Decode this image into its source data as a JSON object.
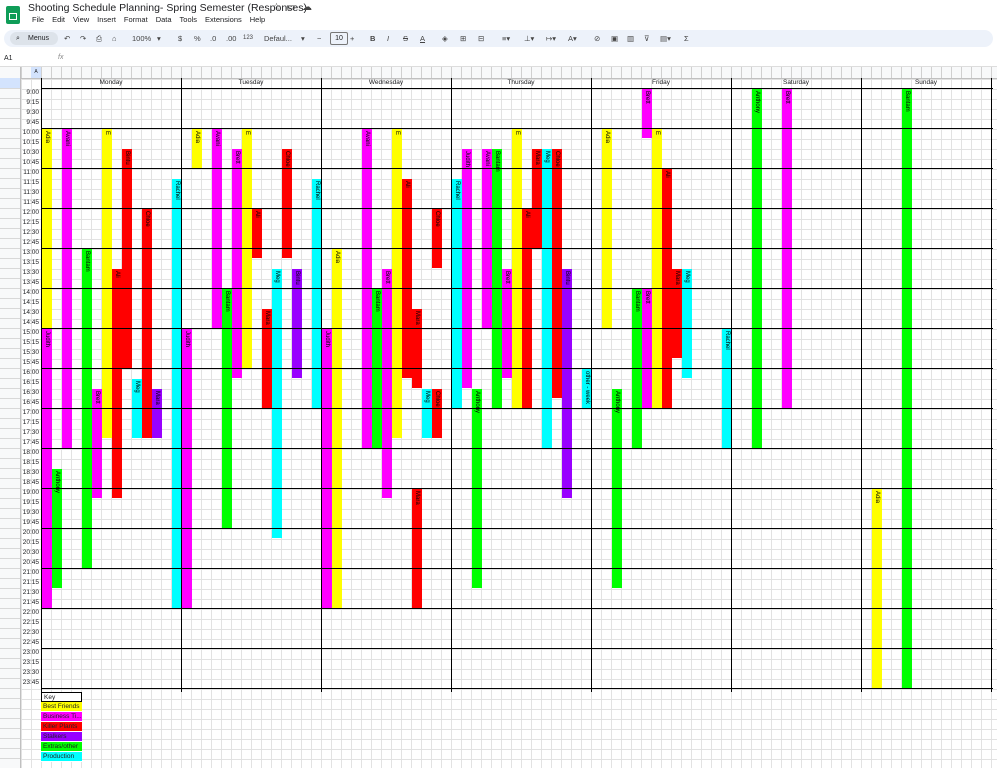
{
  "app": {
    "title": "Shooting Schedule Planning- Spring Semester (Responses)",
    "menus": [
      "File",
      "Edit",
      "View",
      "Insert",
      "Format",
      "Data",
      "Tools",
      "Extensions",
      "Help"
    ]
  },
  "toolbar": {
    "menus_label": "Menus",
    "zoom": "100%",
    "currency": "$",
    "percent": "%",
    "dec_decrease": ".0",
    "dec_increase": ".00",
    "number_format": "123",
    "font": "Defaul...",
    "font_size": "10",
    "bold": "B",
    "italic": "I",
    "strike": "S",
    "text_color": "A",
    "sum": "Σ"
  },
  "formula": {
    "cell": "A1",
    "fx": "fx"
  },
  "days": [
    "Monday",
    "Tuesday",
    "Wednesday",
    "Thursday",
    "Friday",
    "Saturday",
    "Sunday"
  ],
  "times": [
    "9:00",
    "9:15",
    "9:30",
    "9:45",
    "10:00",
    "10:15",
    "10:30",
    "10:45",
    "11:00",
    "11:15",
    "11:30",
    "11:45",
    "12:00",
    "12:15",
    "12:30",
    "12:45",
    "13:00",
    "13:15",
    "13:30",
    "13:45",
    "14:00",
    "14:15",
    "14:30",
    "14:45",
    "15:00",
    "15:15",
    "15:30",
    "15:45",
    "16:00",
    "16:15",
    "16:30",
    "16:45",
    "17:00",
    "17:15",
    "17:30",
    "17:45",
    "18:00",
    "18:15",
    "18:30",
    "18:45",
    "19:00",
    "19:15",
    "19:30",
    "19:45",
    "20:00",
    "20:15",
    "20:30",
    "20:45",
    "21:00",
    "21:15",
    "21:30",
    "21:45",
    "22:00",
    "22:15",
    "22:30",
    "22:45",
    "23:00",
    "23:15",
    "23:30",
    "23:45"
  ],
  "categories": {
    "bf": {
      "label": "Best Friends",
      "color": "#ffff00"
    },
    "bt": {
      "label": "Business Ti...",
      "color": "#ff00ff"
    },
    "kp": {
      "label": "Killer Plants",
      "color": "#ff0000"
    },
    "st": {
      "label": "Stalkers",
      "color": "#9900ff"
    },
    "ex": {
      "label": "Extras/other",
      "color": "#00ff00"
    },
    "pr": {
      "label": "Production",
      "color": "#00ffff"
    }
  },
  "legend": {
    "title": "Key",
    "items": [
      "bf",
      "bt",
      "kp",
      "st",
      "ex",
      "pr"
    ]
  },
  "people": {
    "adia": "Adia",
    "avani": "Avani",
    "e": "E",
    "bintu": "Bintu",
    "ali": "Ali",
    "chloe": "Chloe",
    "rachel": "Rachel",
    "judith": "Judith",
    "bantam": "Bantam",
    "brett": "Brett",
    "meg": "Meg",
    "mara": "Mara",
    "anthony": "Anthony",
    "other": "other - week"
  },
  "shifts": [
    {
      "c": 0,
      "s": 4,
      "e": 36,
      "k": "bf",
      "p": "adia"
    },
    {
      "c": -2,
      "s": 24,
      "e": 52,
      "k": "bt",
      "p": "judith"
    },
    {
      "c": 2,
      "s": 4,
      "e": 36,
      "k": "bt",
      "p": "avani"
    },
    {
      "c": 1,
      "s": 38,
      "e": 50,
      "k": "ex",
      "p": "anthony"
    },
    {
      "c": 4,
      "s": 16,
      "e": 48,
      "k": "ex",
      "p": "bantam"
    },
    {
      "c": 5,
      "s": 30,
      "e": 41,
      "k": "bt",
      "p": "brett"
    },
    {
      "c": 6,
      "s": 4,
      "e": 35,
      "k": "bf",
      "p": "e"
    },
    {
      "c": 7,
      "s": 18,
      "e": 41,
      "k": "kp",
      "p": "ali"
    },
    {
      "c": 8,
      "s": 6,
      "e": 28,
      "k": "kp",
      "p": "bintu"
    },
    {
      "c": 9,
      "s": 29,
      "e": 35,
      "k": "pr",
      "p": "meg"
    },
    {
      "c": 10,
      "s": 12,
      "e": 35,
      "k": "kp",
      "p": "chloe"
    },
    {
      "c": 11,
      "s": 30,
      "e": 35,
      "k": "st",
      "p": "mara"
    },
    {
      "c": 13,
      "s": 9,
      "e": 52,
      "k": "pr",
      "p": "rachel"
    },
    {
      "c": 14,
      "s": 24,
      "e": 52,
      "k": "bt",
      "p": "judith"
    },
    {
      "c": 15,
      "s": 4,
      "e": 8,
      "k": "bf",
      "p": "adia"
    },
    {
      "c": 17,
      "s": 4,
      "e": 24,
      "k": "bt",
      "p": "avani"
    },
    {
      "c": 18,
      "s": 20,
      "e": 44,
      "k": "ex",
      "p": "bantam"
    },
    {
      "c": 19,
      "s": 6,
      "e": 29,
      "k": "bt",
      "p": "brett"
    },
    {
      "c": 20,
      "s": 4,
      "e": 28,
      "k": "bf",
      "p": "e"
    },
    {
      "c": 21,
      "s": 12,
      "e": 17,
      "k": "kp",
      "p": "ali"
    },
    {
      "c": 22,
      "s": 22,
      "e": 32,
      "k": "kp",
      "p": "mara"
    },
    {
      "c": 23,
      "s": 18,
      "e": 45,
      "k": "pr",
      "p": "meg"
    },
    {
      "c": 24,
      "s": 6,
      "e": 17,
      "k": "kp",
      "p": "chloe"
    },
    {
      "c": 25,
      "s": 18,
      "e": 29,
      "k": "st",
      "p": "bintu"
    },
    {
      "c": 27,
      "s": 9,
      "e": 32,
      "k": "pr",
      "p": "rachel"
    },
    {
      "c": 28,
      "s": 24,
      "e": 52,
      "k": "bt",
      "p": "judith"
    },
    {
      "c": 29,
      "s": 16,
      "e": 52,
      "k": "bf",
      "p": "adia"
    },
    {
      "c": 32,
      "s": 4,
      "e": 36,
      "k": "bt",
      "p": "avani"
    },
    {
      "c": 33,
      "s": 20,
      "e": 36,
      "k": "ex",
      "p": "bantam"
    },
    {
      "c": 34,
      "s": 18,
      "e": 41,
      "k": "bt",
      "p": "brett"
    },
    {
      "c": 35,
      "s": 4,
      "e": 35,
      "k": "bf",
      "p": "e"
    },
    {
      "c": 36,
      "s": 9,
      "e": 29,
      "k": "kp",
      "p": "ali"
    },
    {
      "c": 37,
      "s": 22,
      "e": 30,
      "k": "kp",
      "p": "mara"
    },
    {
      "c": 37,
      "s": 40,
      "e": 52,
      "k": "kp",
      "p": "mara"
    },
    {
      "c": 38,
      "s": 30,
      "e": 35,
      "k": "pr",
      "p": "meg"
    },
    {
      "c": 39,
      "s": 12,
      "e": 18,
      "k": "kp",
      "p": "chloe"
    },
    {
      "c": 39,
      "s": 30,
      "e": 35,
      "k": "kp",
      "p": "chloe"
    },
    {
      "c": 41,
      "s": 9,
      "e": 32,
      "k": "pr",
      "p": "rachel"
    },
    {
      "c": 42,
      "s": 6,
      "e": 30,
      "k": "bt",
      "p": "judith"
    },
    {
      "c": 44,
      "s": 6,
      "e": 24,
      "k": "bt",
      "p": "avani"
    },
    {
      "c": 43,
      "s": 30,
      "e": 50,
      "k": "ex",
      "p": "anthony"
    },
    {
      "c": 45,
      "s": 6,
      "e": 32,
      "k": "ex",
      "p": "bantam"
    },
    {
      "c": 46,
      "s": 18,
      "e": 29,
      "k": "bt",
      "p": "brett"
    },
    {
      "c": 47,
      "s": 4,
      "e": 32,
      "k": "bf",
      "p": "e"
    },
    {
      "c": 48,
      "s": 12,
      "e": 32,
      "k": "kp",
      "p": "ali"
    },
    {
      "c": 49,
      "s": 6,
      "e": 16,
      "k": "kp",
      "p": "mara"
    },
    {
      "c": 50,
      "s": 6,
      "e": 36,
      "k": "pr",
      "p": "meg"
    },
    {
      "c": 51,
      "s": 6,
      "e": 31,
      "k": "kp",
      "p": "chloe"
    },
    {
      "c": 52,
      "s": 18,
      "e": 41,
      "k": "st",
      "p": "bintu"
    },
    {
      "c": 54,
      "s": 28,
      "e": 32,
      "k": "pr",
      "p": "other"
    },
    {
      "c": 56,
      "s": 4,
      "e": 24,
      "k": "bf",
      "p": "adia"
    },
    {
      "c": 57,
      "s": 30,
      "e": 50,
      "k": "ex",
      "p": "anthony"
    },
    {
      "c": 59,
      "s": 20,
      "e": 36,
      "k": "ex",
      "p": "bantam"
    },
    {
      "c": 60,
      "s": 0,
      "e": 5,
      "k": "bt",
      "p": "brett"
    },
    {
      "c": 60,
      "s": 20,
      "e": 32,
      "k": "bt",
      "p": "brett"
    },
    {
      "c": 61,
      "s": 4,
      "e": 32,
      "k": "bf",
      "p": "e"
    },
    {
      "c": 62,
      "s": 8,
      "e": 32,
      "k": "kp",
      "p": "ali"
    },
    {
      "c": 63,
      "s": 18,
      "e": 27,
      "k": "kp",
      "p": "mara"
    },
    {
      "c": 64,
      "s": 18,
      "e": 29,
      "k": "pr",
      "p": "meg"
    },
    {
      "c": 68,
      "s": 24,
      "e": 36,
      "k": "pr",
      "p": "rachel"
    },
    {
      "c": 71,
      "s": 0,
      "e": 36,
      "k": "ex",
      "p": "anthony"
    },
    {
      "c": 74,
      "s": 0,
      "e": 32,
      "k": "bt",
      "p": "brett"
    },
    {
      "c": 83,
      "s": 40,
      "e": 60,
      "k": "bf",
      "p": "adia"
    },
    {
      "c": 86,
      "s": 0,
      "e": 60,
      "k": "ex",
      "p": "bantam"
    }
  ]
}
